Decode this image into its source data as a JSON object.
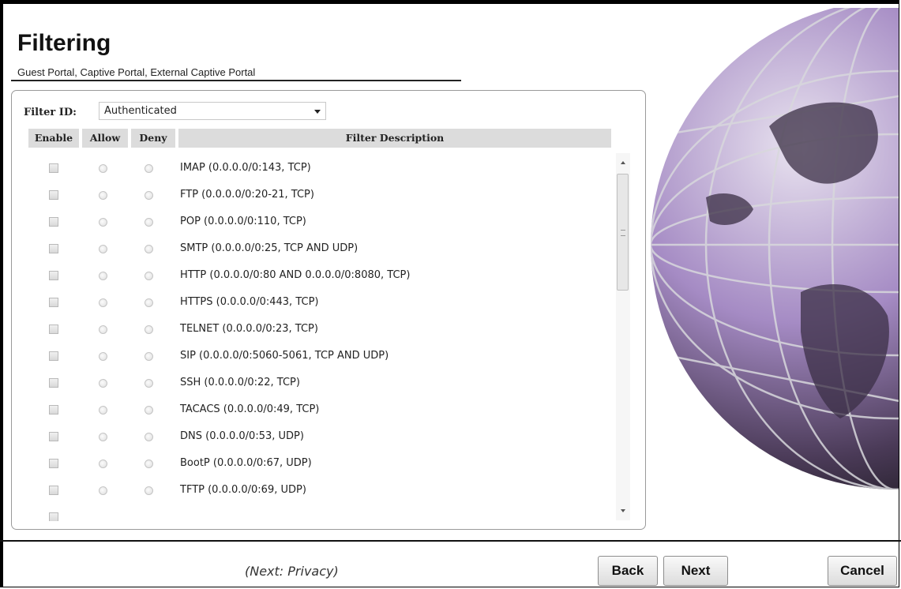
{
  "header": {
    "title": "Filtering",
    "subtitle": "Guest Portal, Captive Portal, External Captive Portal"
  },
  "filter": {
    "id_label": "Filter ID:",
    "selected": "Authenticated"
  },
  "table": {
    "columns": [
      "Enable",
      "Allow",
      "Deny",
      "Filter Description"
    ],
    "rows": [
      "IMAP (0.0.0.0/0:143, TCP)",
      "FTP (0.0.0.0/0:20-21, TCP)",
      "POP (0.0.0.0/0:110, TCP)",
      "SMTP (0.0.0.0/0:25, TCP AND UDP)",
      "HTTP (0.0.0.0/0:80 AND 0.0.0.0/0:8080, TCP)",
      "HTTPS (0.0.0.0/0:443, TCP)",
      "TELNET (0.0.0.0/0:23, TCP)",
      "SIP (0.0.0.0/0:5060-5061, TCP AND UDP)",
      "SSH (0.0.0.0/0:22, TCP)",
      "TACACS (0.0.0.0/0:49, TCP)",
      "DNS (0.0.0.0/0:53, UDP)",
      "BootP (0.0.0.0/0:67, UDP)",
      "TFTP (0.0.0.0/0:69, UDP)"
    ]
  },
  "footer": {
    "next_hint": "(Next: Privacy)",
    "back_label": "Back",
    "next_label": "Next",
    "cancel_label": "Cancel"
  },
  "colors": {
    "globe_purple": "#8a6fb0",
    "header_bg": "#dcdcdc"
  },
  "icons": {
    "select_caret": "chevron-down-icon",
    "decorative_image": "globe-icon"
  }
}
